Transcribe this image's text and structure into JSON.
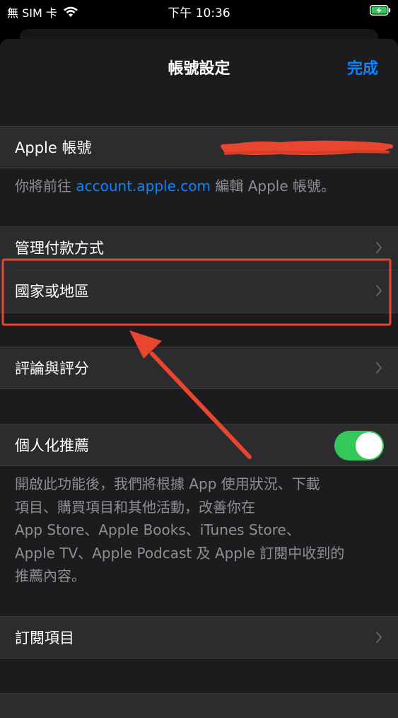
{
  "status_bar": {
    "carrier": "無 SIM 卡",
    "time": "下午 10:36"
  },
  "nav": {
    "title": "帳號設定",
    "done_label": "完成"
  },
  "apple_account": {
    "label": "Apple 帳號"
  },
  "account_note": {
    "prefix": "你將前往 ",
    "link": "account.apple.com",
    "suffix": " 編輯 Apple 帳號。"
  },
  "menu": {
    "payment": "管理付款方式",
    "region": "國家或地區",
    "reviews": "評論與評分"
  },
  "personalized": {
    "label": "個人化推薦",
    "enabled": true,
    "toggle_color": "#34c759",
    "description_lines": [
      "開啟此功能後，我們將根據 App 使用狀況、下載",
      "項目、購買項目和其他活動，改善你在",
      "App Store、Apple Books、iTunes Store、",
      "Apple TV、Apple Podcast 及 Apple 訂閱中收到的",
      "推薦內容。"
    ]
  },
  "subscriptions": {
    "label": "訂閱項目"
  },
  "colors": {
    "accent": "#0a84ff",
    "annotation_red": "#e8462f"
  },
  "icons": {
    "wifi": "wifi-icon",
    "battery": "battery-charging-icon",
    "chevron": "chevron-right-icon"
  }
}
